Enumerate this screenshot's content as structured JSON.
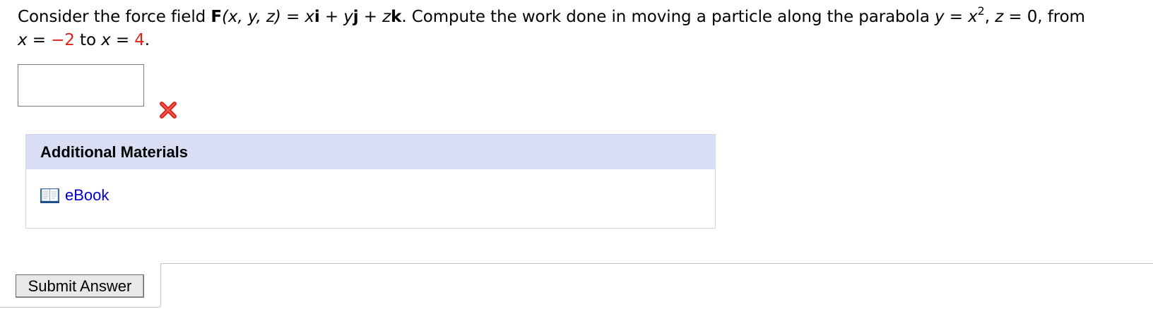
{
  "question": {
    "intro": "Consider the force field ",
    "field_symbol": "F",
    "field_args": "(x, y, z)",
    "equals": " = ",
    "term1_var": "x",
    "term1_unit": "i",
    "plus1": " + ",
    "term2_var": "y",
    "term2_unit": "j",
    "plus2": " + ",
    "term3_var": "z",
    "term3_unit": "k",
    "middle": ". Compute the work done in moving a particle along the parabola ",
    "curve_y": "y",
    "curve_eq": " = ",
    "curve_x": "x",
    "curve_exp": "2",
    "curve_sep": ", ",
    "curve_z": "z",
    "curve_z_eq": " = 0, from",
    "from_var": "x",
    "from_eq": " = ",
    "from_value": "−2",
    "to_text": " to ",
    "to_var": "x",
    "to_eq": " = ",
    "to_value": "4",
    "end": "."
  },
  "answer": {
    "value": "",
    "placeholder": ""
  },
  "status": {
    "icon": "wrong-x-icon",
    "color": "#e0201a"
  },
  "materials": {
    "header": "Additional Materials",
    "ebook_label": "eBook",
    "ebook_icon": "book-icon"
  },
  "actions": {
    "submit_label": "Submit Answer"
  },
  "colors": {
    "highlight": "#e0201a",
    "header_bg": "#d9def5",
    "link": "#0000cc"
  }
}
